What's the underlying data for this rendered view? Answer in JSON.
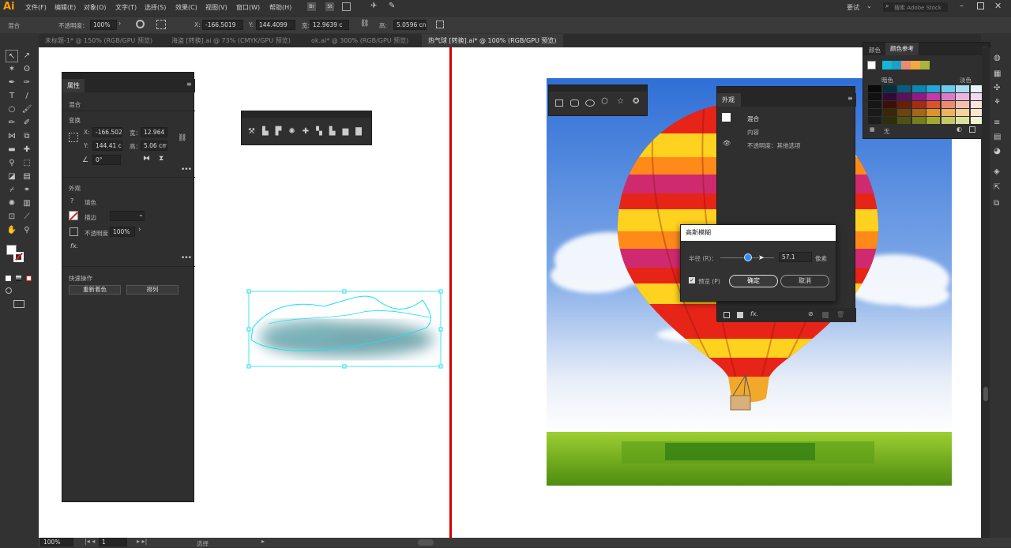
{
  "app": {
    "logo": "Ai",
    "workspace": "要试",
    "search_placeholder": "搜索 Adobe Stock"
  },
  "menu": [
    "文件(F)",
    "编辑(E)",
    "对象(O)",
    "文字(T)",
    "选择(S)",
    "效果(C)",
    "视图(V)",
    "窗口(W)",
    "帮助(H)"
  ],
  "topicons": [
    "Br",
    "St"
  ],
  "options": {
    "mode": "混合",
    "opacity_label": "不透明度：",
    "opacity": "100%",
    "x_label": "X:",
    "x": "-166.5019",
    "y_label": "Y:",
    "y": "144.4099",
    "w_label": "宽:",
    "w": "12.9639 c",
    "h_label": "高:",
    "h": "5.0596 cn"
  },
  "tabs": [
    "未标题-1* @ 150% (RGB/GPU 预览)",
    "海盗 [转换].ai @ 73% (CMYK/GPU 预览)",
    "ok.ai* @ 300% (RGB/GPU 预览)",
    "热气球 [转换].ai* @ 100% (RGB/GPU 预览)"
  ],
  "properties": {
    "title": "属性",
    "section_mixed": "混合",
    "section_transform": "变换",
    "x": "-166.502",
    "y": "144.41 c",
    "w_label": "宽：",
    "w": "12.964 c",
    "h_label": "高：",
    "h": "5.06 cm",
    "angle": "0°",
    "section_appearance": "外观",
    "fill_label": "填色",
    "stroke_label": "描边",
    "opacity_label": "不透明度",
    "opacity": "100%",
    "fx": "fx.",
    "section_quick": "快速操作",
    "recolor_btn": "重新着色",
    "arrange_btn": "排列"
  },
  "appearance": {
    "title": "外观",
    "row1": "混合",
    "row2": "内容",
    "row3": "不透明度：其他选项",
    "fx": "fx."
  },
  "dialog": {
    "title": "高斯模糊",
    "radius_label": "半径 (R)：",
    "radius_value": "57.1",
    "unit": "像素",
    "preview_label": "预览 (P)",
    "preview_checked": true,
    "ok": "确定",
    "cancel": "取消",
    "slider_fraction": 0.52
  },
  "color_panel": {
    "tab1": "颜色",
    "tab2": "颜色参考",
    "dark_label": "暗色",
    "light_label": "淡色",
    "none_label": "无",
    "header_colors": [
      "#16b6d6",
      "#19a1c9",
      "#e98b73",
      "#f2a843",
      "#aab43a"
    ],
    "grid": [
      [
        "#0a0a0a",
        "#06303f",
        "#075d7a",
        "#0a88b2",
        "#21a8d6",
        "#6bcbed",
        "#a7e0f3",
        "#e8f6fb"
      ],
      [
        "#111",
        "#2f0a3a",
        "#5a1060",
        "#8f1a8a",
        "#c03cad",
        "#d97bc8",
        "#ecb4e0",
        "#f5d9ef"
      ],
      [
        "#161616",
        "#3a1108",
        "#6b1d0b",
        "#a32c11",
        "#d9532c",
        "#e98b73",
        "#f3bfae",
        "#fbe4dc"
      ],
      [
        "#1a1a1a",
        "#3a260b",
        "#6b4410",
        "#a4661a",
        "#dd922c",
        "#f0b161",
        "#f7d19c",
        "#fbe8cc"
      ],
      [
        "#1e1e1e",
        "#2d2f0c",
        "#4f5213",
        "#787d1d",
        "#a4aa2d",
        "#c4c964",
        "#dde19e",
        "#f0f2d2"
      ]
    ]
  },
  "statusbar": {
    "zoom": "100%",
    "artboard": "1",
    "mode": "选择"
  },
  "colors": {
    "accent": "#2d8ef5",
    "selection": "#19e0f0",
    "artboard_divider": "#d40000",
    "sky_top": "#2f6fd6",
    "sky_bottom": "#e8eef8",
    "grass": "#76b020"
  }
}
